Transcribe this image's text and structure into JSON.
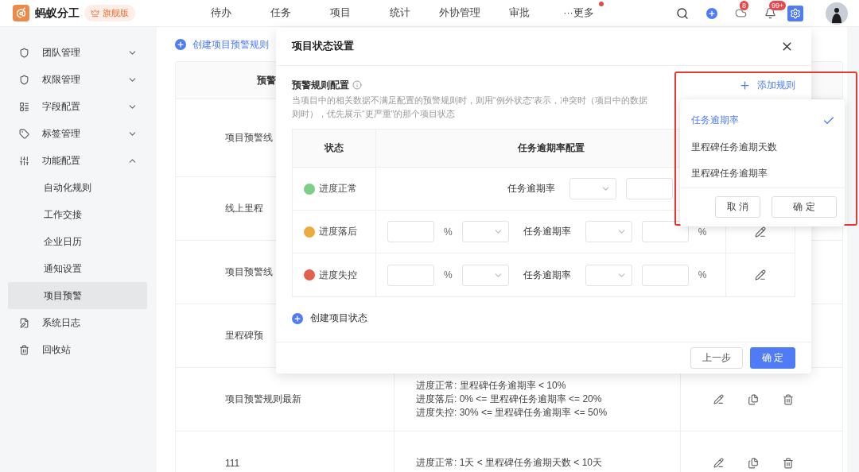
{
  "app": {
    "name": "蚂蚁分工",
    "edition": "旗舰版"
  },
  "nav": [
    {
      "label": "待办",
      "dot": false
    },
    {
      "label": "任务",
      "dot": false
    },
    {
      "label": "项目",
      "dot": false
    },
    {
      "label": "统计",
      "dot": false
    },
    {
      "label": "外协管理",
      "dot": false
    },
    {
      "label": "审批",
      "dot": false
    },
    {
      "label": "···更多",
      "dot": true
    }
  ],
  "toolbar": {
    "cloud_badge": "8",
    "bell_badge": "99+"
  },
  "sidebar": {
    "items": [
      {
        "label": "团队管理",
        "expanded": false,
        "selected": false
      },
      {
        "label": "权限管理",
        "expanded": false,
        "selected": false
      },
      {
        "label": "字段配置",
        "expanded": false,
        "selected": false
      },
      {
        "label": "标签管理",
        "expanded": false,
        "selected": false
      },
      {
        "label": "功能配置",
        "expanded": true,
        "selected": false,
        "children": [
          {
            "label": "自动化规则",
            "selected": false
          },
          {
            "label": "工作交接",
            "selected": false
          },
          {
            "label": "企业日历",
            "selected": false
          },
          {
            "label": "通知设置",
            "selected": false
          },
          {
            "label": "项目预警",
            "selected": true
          }
        ]
      },
      {
        "label": "系统日志",
        "selected": false
      },
      {
        "label": "回收站",
        "selected": false
      }
    ]
  },
  "page": {
    "create_link": "创建项目预警规则",
    "header": "预警",
    "rows": [
      {
        "name": "项目预警线",
        "rules": []
      },
      {
        "name": "线上里程",
        "rules": []
      },
      {
        "name": "项目预警线",
        "rules": []
      },
      {
        "name": "里程碑预",
        "rules": []
      },
      {
        "name": "项目预警规则最新",
        "rules": [
          "进度正常: 里程碑任务逾期率 < 10%",
          "进度落后: 0% <= 里程碑任务逾期率 <= 20%",
          "进度失控: 30% <= 里程碑任务逾期率 <= 50%"
        ]
      },
      {
        "name": "111",
        "rules": [
          "进度正常: 1天 < 里程碑任务逾期天数 < 10天"
        ]
      }
    ]
  },
  "modal": {
    "title": "项目状态设置",
    "section_title": "预警规则配置",
    "description": [
      "当项目中的相关数据不满足配置的预警规则时，则用“例外状态”表示，冲突时（项目中的数据",
      "则时），优先展示“更严重”的那个项目状态"
    ],
    "add_rule": "添加规则",
    "columns": [
      "状态",
      "任务逾期率配置"
    ],
    "rows": [
      {
        "kind": "single",
        "status": "进度正常",
        "color": "#7ccf85",
        "metric": "任务逾期率"
      },
      {
        "kind": "range",
        "status": "进度落后",
        "color": "#eeab3d",
        "unit": "%",
        "metric": "任务逾期率",
        "unit_end": "%"
      },
      {
        "kind": "range",
        "status": "进度失控",
        "color": "#e3604a",
        "unit": "%",
        "metric": "任务逾期率",
        "unit_end": "%"
      }
    ],
    "create_status": "创建项目状态",
    "back": "上一步",
    "confirm": "确 定"
  },
  "rule_menu": {
    "options": [
      {
        "label": "任务逾期率",
        "selected": true
      },
      {
        "label": "里程碑任务逾期天数",
        "selected": false
      },
      {
        "label": "里程碑任务逾期率",
        "selected": false
      }
    ],
    "cancel": "取 消",
    "confirm": "确 定"
  }
}
